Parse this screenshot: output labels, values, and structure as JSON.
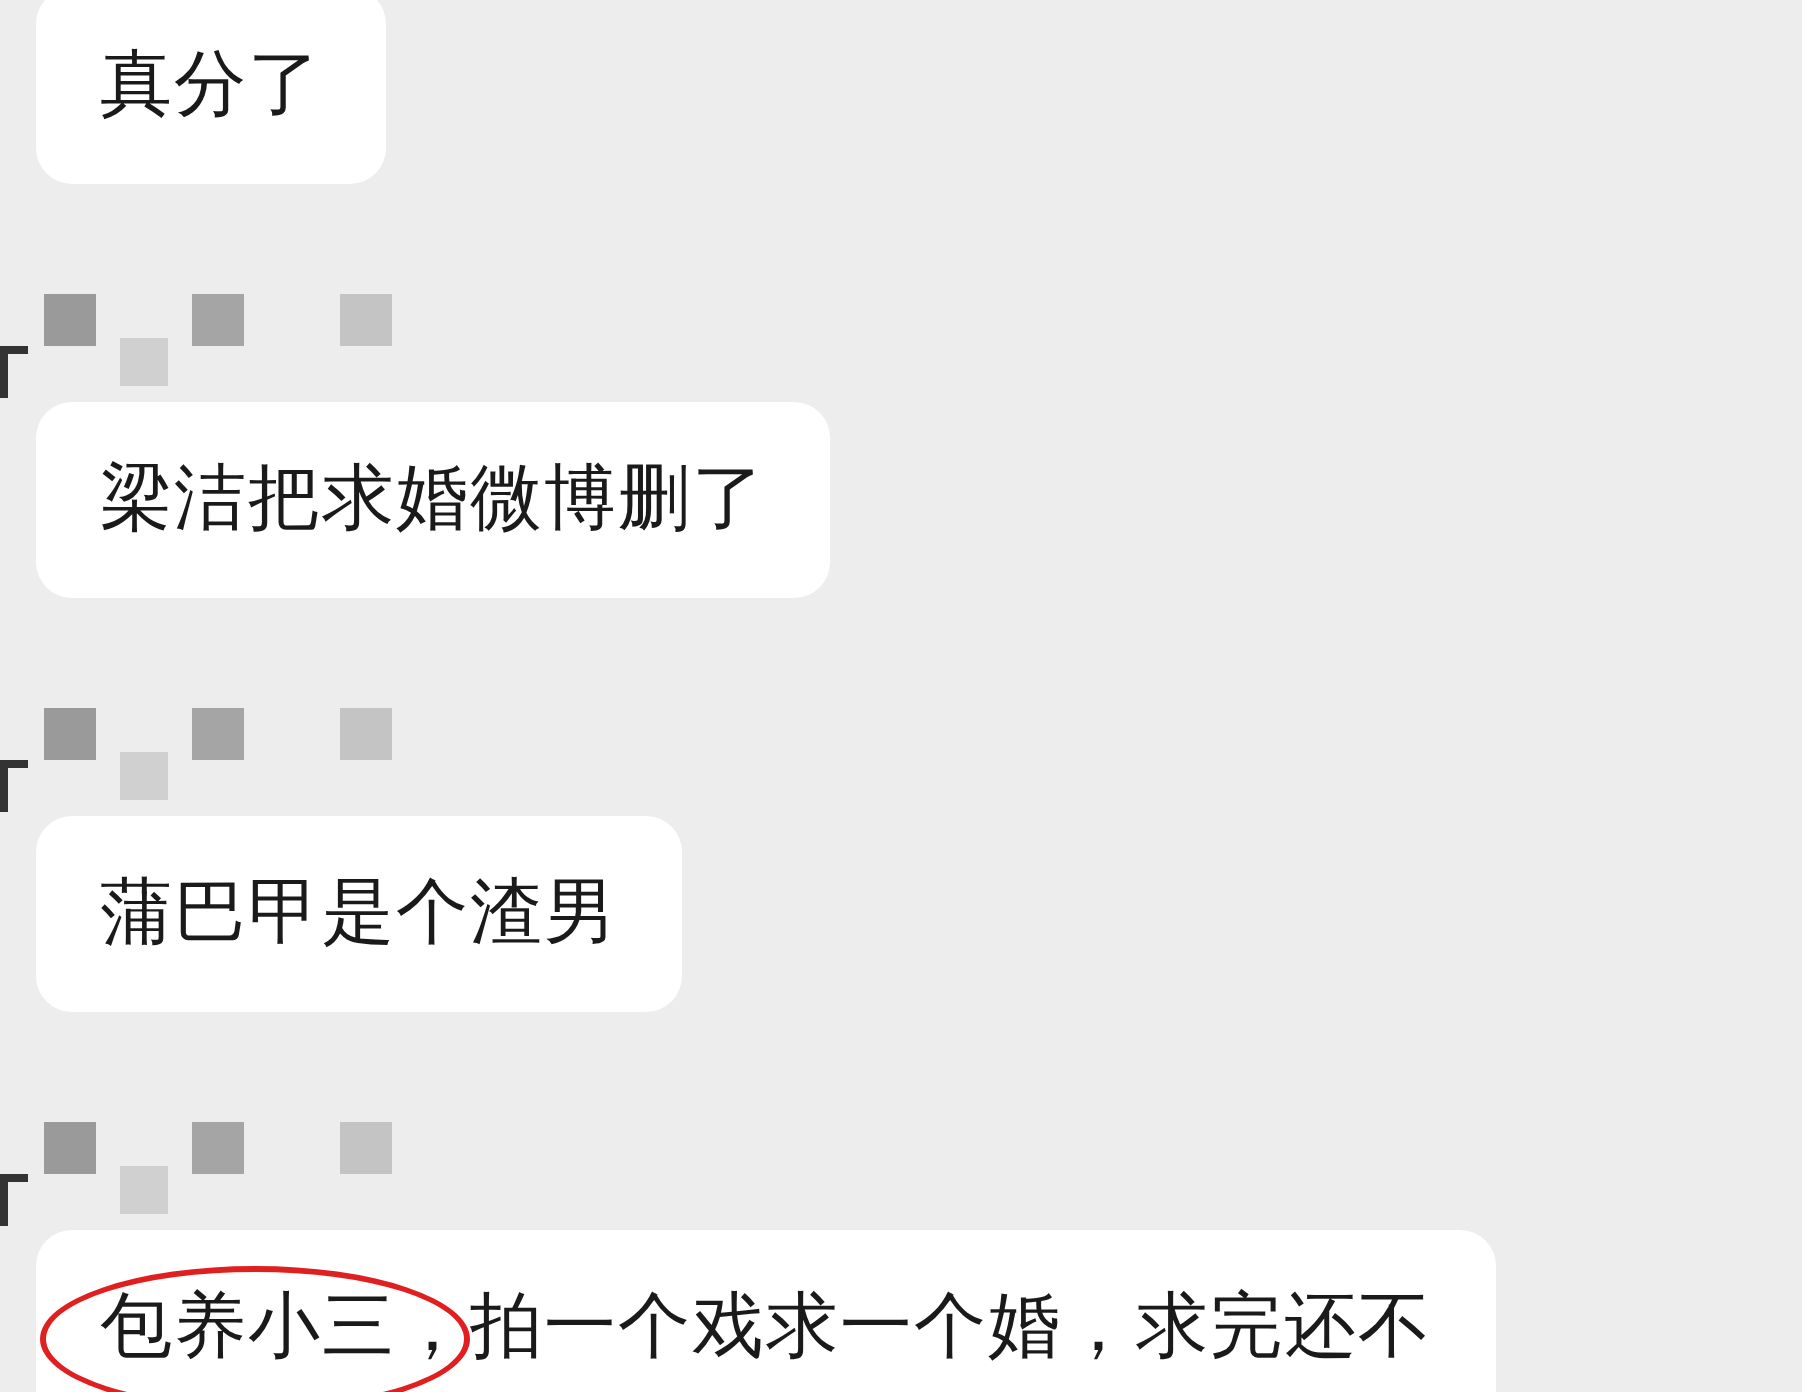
{
  "messages": [
    {
      "text": "真分了",
      "sender_censored": false
    },
    {
      "text": "梁洁把求婚微博删了",
      "sender_censored": true
    },
    {
      "text": "蒲巴甲是个渣男",
      "sender_censored": true
    },
    {
      "circled": "包养小三，",
      "text": "拍一个戏求一个婚，求完还不",
      "sender_censored": true
    }
  ]
}
